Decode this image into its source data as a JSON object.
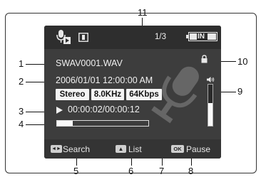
{
  "callouts": {
    "n1": "1",
    "n2": "2",
    "n3": "3",
    "n4": "4",
    "n5": "5",
    "n6": "6",
    "n7": "7",
    "n8": "8",
    "n9": "9",
    "n10": "10",
    "n11": "11"
  },
  "status": {
    "mode_icon": "voice-record-play-icon",
    "card_icon": "memory-card-icon",
    "file_counter": "1/3",
    "battery_icon": "battery-icon",
    "battery_label": "IN"
  },
  "file": {
    "name": "SWAV0001.WAV",
    "datetime": "2006/01/01 12:00:00 AM",
    "lock_icon": "lock-icon"
  },
  "audio_specs": {
    "channels": "Stereo",
    "sample_rate": "8.0KHz",
    "bitrate": "64Kbps"
  },
  "playback": {
    "play_icon": "play-icon",
    "time": "00:00:02/00:00:12",
    "progress_fraction": 0.17
  },
  "volume": {
    "icon": "speaker-icon",
    "level_fraction": 0.55
  },
  "bottom_bar": {
    "search_key": "◄►",
    "search_label": "Search",
    "list_key": "▲",
    "list_label": "List",
    "ok_key": "OK",
    "pause_label": "Pause"
  }
}
